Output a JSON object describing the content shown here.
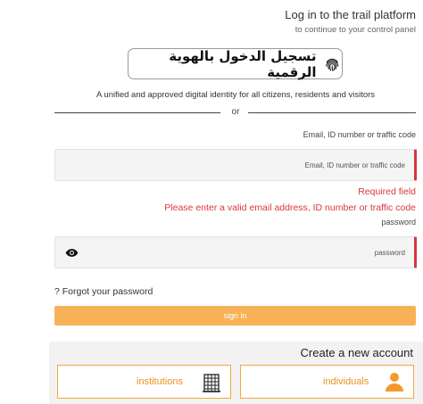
{
  "header": {
    "title": "Log in to the trail platform",
    "subtitle": "to continue to your control panel"
  },
  "nafath": {
    "label": "تسجيل الدخول بالهوية الرقمية",
    "icon": "fingerprint-icon"
  },
  "tagline": "A unified and approved digital identity for all citizens, residents and visitors",
  "divider": {
    "text": "or"
  },
  "email_field": {
    "label": "Email, ID number or traffic code",
    "placeholder": "Email, ID number or traffic code",
    "value": ""
  },
  "errors": {
    "required": "Required field",
    "invalid": "Please enter a valid email address, ID number or traffic code"
  },
  "password_field": {
    "label": "password",
    "placeholder": "password",
    "value": "",
    "toggle_icon": "eye-icon"
  },
  "forgot_link": "? Forgot your password",
  "signin_button": "sign in",
  "create_account": {
    "title": "Create a new account",
    "options": [
      {
        "label": "institutions",
        "icon": "building-icon"
      },
      {
        "label": "individuals",
        "icon": "person-icon"
      }
    ]
  },
  "colors": {
    "accent": "#f7b257",
    "accent_text": "#e8921f",
    "error": "#d9363e",
    "icon_orange": "#f39a2b"
  }
}
